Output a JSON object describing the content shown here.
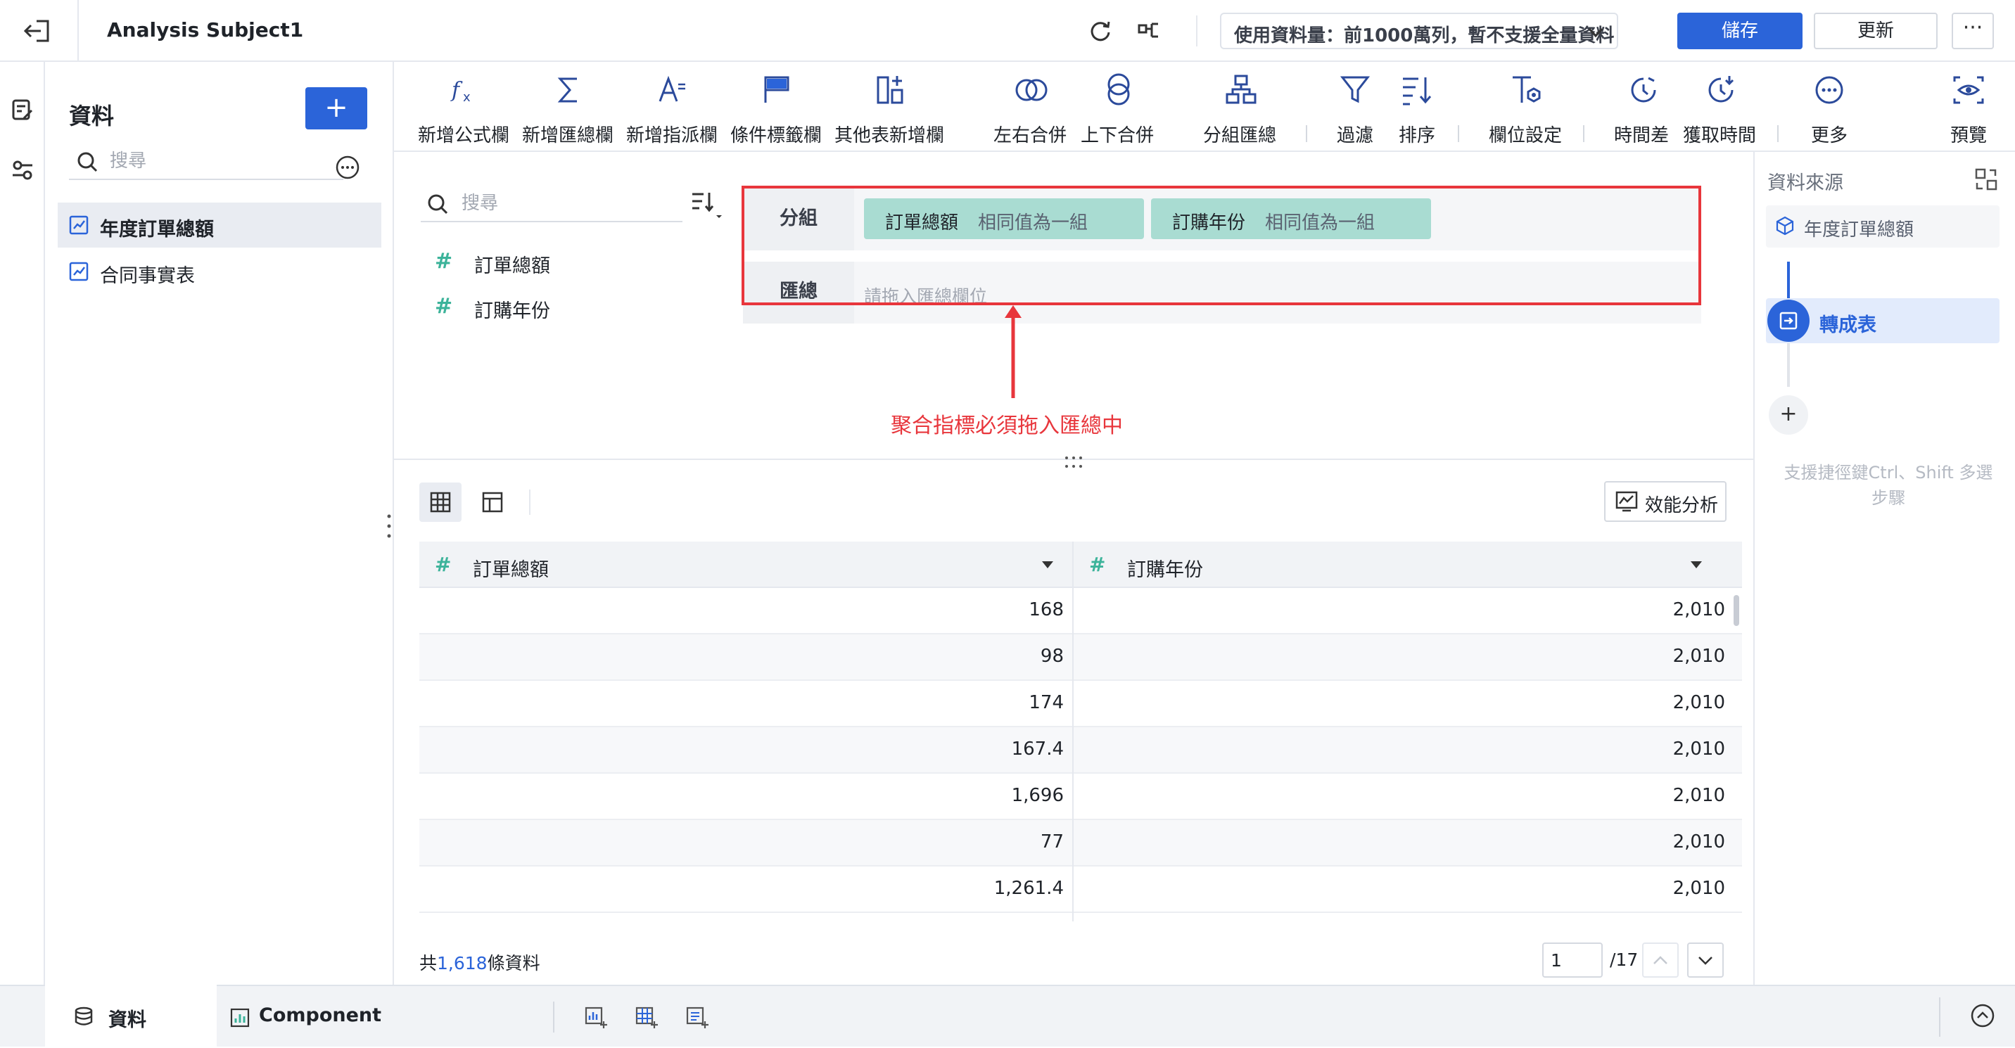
{
  "topbar": {
    "title": "Analysis Subject1",
    "data_volume": "使用資料量：前1000萬列，暫不支援全量資料",
    "save_label": "儲存",
    "update_label": "更新",
    "more_label": "···"
  },
  "left_panel": {
    "title": "資料",
    "add_label": "+",
    "search_placeholder": "搜尋",
    "items": [
      {
        "label": "年度訂單總額",
        "selected": true
      },
      {
        "label": "合同事實表",
        "selected": false
      }
    ]
  },
  "toolbar": {
    "tools": [
      {
        "label": "新增公式欄",
        "icon": "formula-icon"
      },
      {
        "label": "新增匯總欄",
        "icon": "sigma-icon"
      },
      {
        "label": "新增指派欄",
        "icon": "assign-icon"
      },
      {
        "label": "條件標籤欄",
        "icon": "flag-icon"
      },
      {
        "label": "其他表新增欄",
        "icon": "add-column-icon"
      },
      {
        "label": "左右合併",
        "icon": "left-right-merge-icon"
      },
      {
        "label": "上下合併",
        "icon": "top-bottom-merge-icon"
      },
      {
        "label": "分組匯總",
        "icon": "group-summary-icon"
      },
      {
        "label": "過濾",
        "icon": "filter-icon"
      },
      {
        "label": "排序",
        "icon": "sort-icon"
      },
      {
        "label": "欄位設定",
        "icon": "field-settings-icon"
      },
      {
        "label": "時間差",
        "icon": "time-diff-icon"
      },
      {
        "label": "獲取時間",
        "icon": "get-time-icon"
      },
      {
        "label": "更多",
        "icon": "more-icon"
      },
      {
        "label": "預覽",
        "icon": "preview-icon"
      }
    ]
  },
  "fields_panel": {
    "search_placeholder": "搜尋",
    "fields": [
      {
        "label": "訂單總額",
        "type_symbol": "#"
      },
      {
        "label": "訂購年份",
        "type_symbol": "#"
      }
    ]
  },
  "group_config": {
    "group_label": "分組",
    "summary_label": "匯總",
    "group_chips": [
      {
        "name": "訂單總額",
        "mode": "相同值為一組"
      },
      {
        "name": "訂購年份",
        "mode": "相同值為一組"
      }
    ],
    "summary_placeholder": "請拖入匯總欄位",
    "annotation": "聚合指標必須拖入匯總中"
  },
  "table": {
    "perf_label": "效能分析",
    "columns": [
      {
        "label": "訂單總額",
        "type_symbol": "#"
      },
      {
        "label": "訂購年份",
        "type_symbol": "#"
      }
    ],
    "rows": [
      [
        "168",
        "2,010"
      ],
      [
        "98",
        "2,010"
      ],
      [
        "174",
        "2,010"
      ],
      [
        "167.4",
        "2,010"
      ],
      [
        "1,696",
        "2,010"
      ],
      [
        "77",
        "2,010"
      ],
      [
        "1,261.4",
        "2,010"
      ]
    ],
    "total_prefix": "共",
    "total_count": "1,618",
    "total_suffix": "條資料",
    "page_current": "1",
    "page_total": "/17"
  },
  "right_panel": {
    "title": "資料來源",
    "source_label": "年度訂單總額",
    "step_label": "轉成表",
    "add_label": "+",
    "hint": "支援捷徑鍵Ctrl、Shift 多選步驟"
  },
  "bottom_bar": {
    "tab_data": "資料",
    "tab_component": "Component"
  },
  "colors": {
    "accent": "#2b64d9",
    "chip": "#a9dcd2",
    "field_hash": "#3cb39a",
    "annotation": "#e8363c"
  }
}
